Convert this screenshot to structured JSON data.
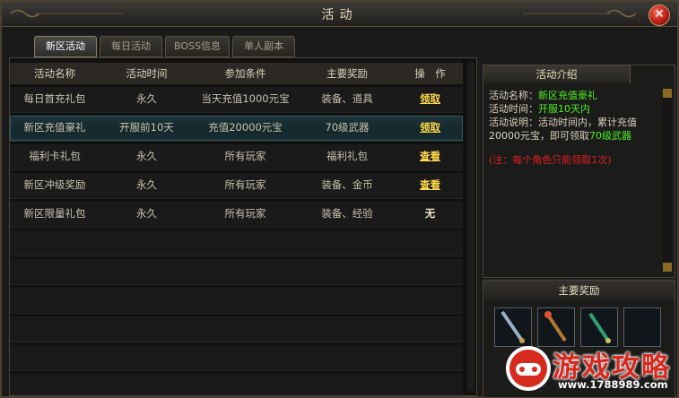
{
  "window": {
    "title": "活动",
    "close_label": "✕"
  },
  "tabs": [
    {
      "label": "新区活动",
      "active": true
    },
    {
      "label": "每日活动",
      "active": false
    },
    {
      "label": "BOSS信息",
      "active": false
    },
    {
      "label": "单人副本",
      "active": false
    }
  ],
  "table": {
    "headers": [
      "活动名称",
      "活动时间",
      "参加条件",
      "主要奖励",
      "操　作"
    ],
    "rows": [
      {
        "name": "每日首充礼包",
        "time": "永久",
        "cond": "当天充值1000元宝",
        "reward": "装备、道具",
        "action": "领取"
      },
      {
        "name": "新区充值豪礼",
        "time": "开服前10天",
        "cond": "充值20000元宝",
        "reward": "70级武器",
        "action": "领取",
        "selected": true
      },
      {
        "name": "福利卡礼包",
        "time": "永久",
        "cond": "所有玩家",
        "reward": "福利礼包",
        "action": "查看"
      },
      {
        "name": "新区冲级奖励",
        "time": "永久",
        "cond": "所有玩家",
        "reward": "装备、金币",
        "action": "查看"
      },
      {
        "name": "新区限量礼包",
        "time": "永久",
        "cond": "所有玩家",
        "reward": "装备、经验",
        "action": "无"
      }
    ]
  },
  "intro": {
    "heading": "活动介绍",
    "name_label": "活动名称：",
    "name_value": "新区充值豪礼",
    "time_label": "活动时间：",
    "time_value": "开服10天内",
    "desc_label": "活动说明：活动时间内，累计充值20000元宝，即可领取",
    "desc_value": "70级武器",
    "note": "(注：每个角色只能领取1次)"
  },
  "rewards": {
    "heading": "主要奖励"
  },
  "watermark": {
    "title": "游戏攻略",
    "url": "www.1788989.com"
  },
  "colors": {
    "accent_green": "#4cf020",
    "note_red": "#e02020",
    "action_yellow": "#ffd84a"
  }
}
